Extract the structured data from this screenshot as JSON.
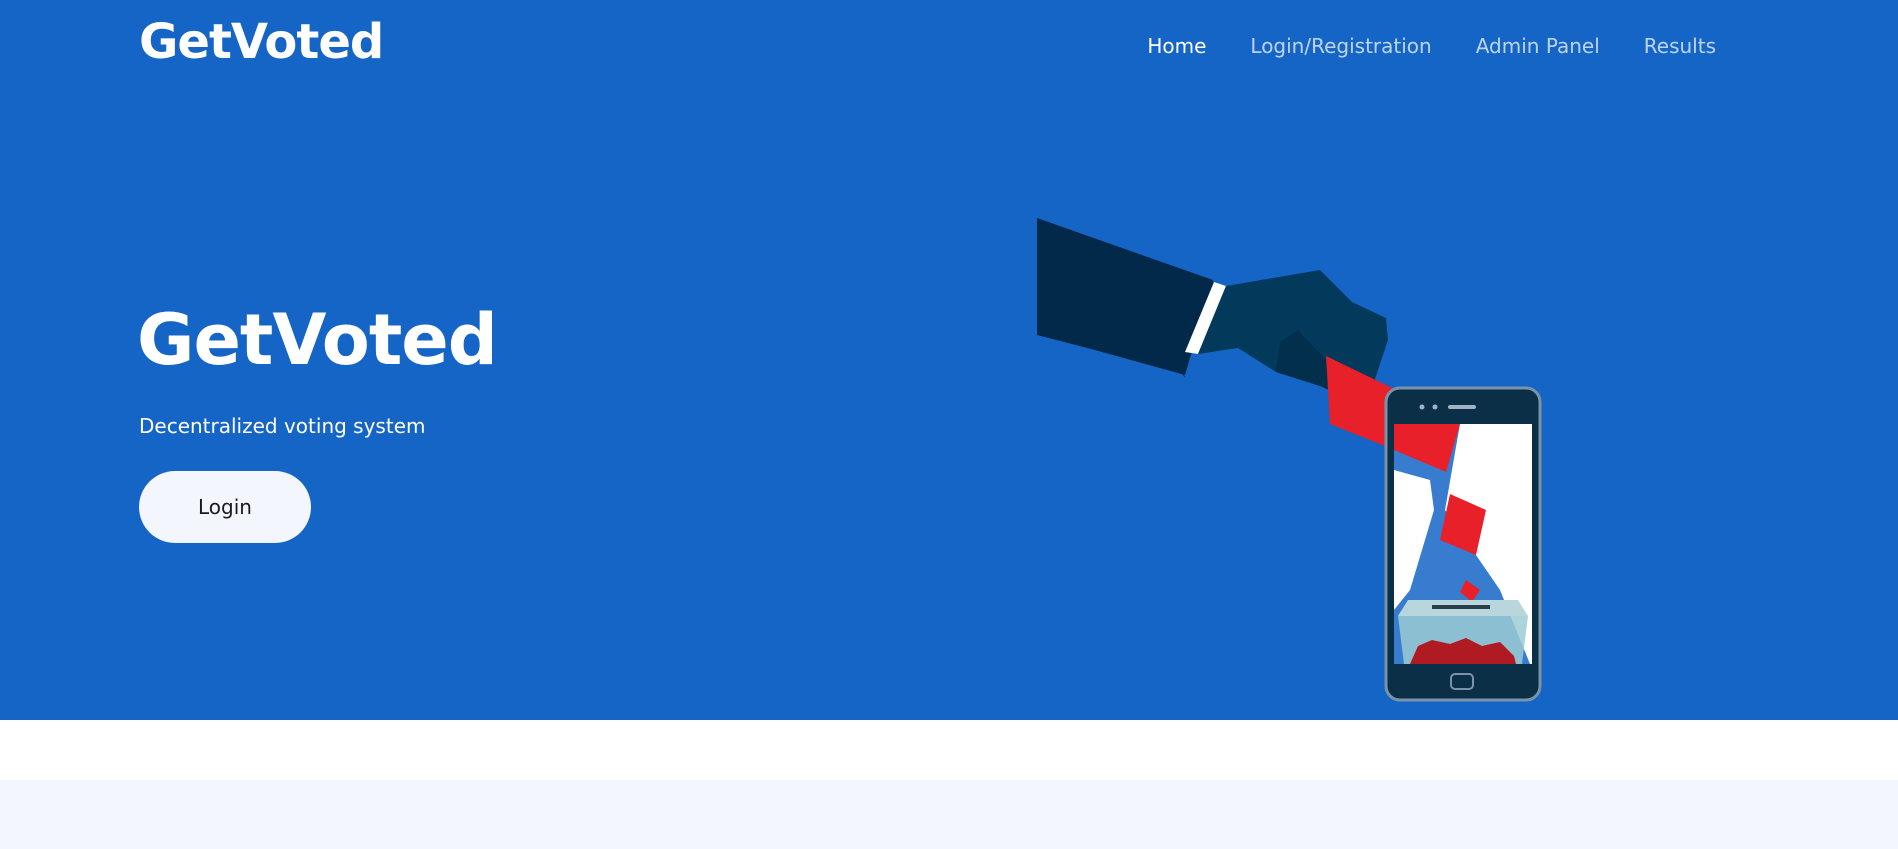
{
  "header": {
    "brand": "GetVoted",
    "nav": [
      {
        "label": "Home",
        "active": true
      },
      {
        "label": "Login/Registration",
        "active": false
      },
      {
        "label": "Admin Panel",
        "active": false
      },
      {
        "label": "Results",
        "active": false
      }
    ]
  },
  "hero": {
    "title": "GetVoted",
    "subtitle": "Decentralized voting system",
    "login_button": "Login",
    "illustration": "hand-casting-vote-into-smartphone-ballot-box"
  },
  "colors": {
    "hero_background": "#1565c7",
    "button_background": "#f3f6fd",
    "section_background": "#f4f6fd",
    "ballot_red": "#e8202a",
    "sleeve_navy": "#03294a"
  }
}
